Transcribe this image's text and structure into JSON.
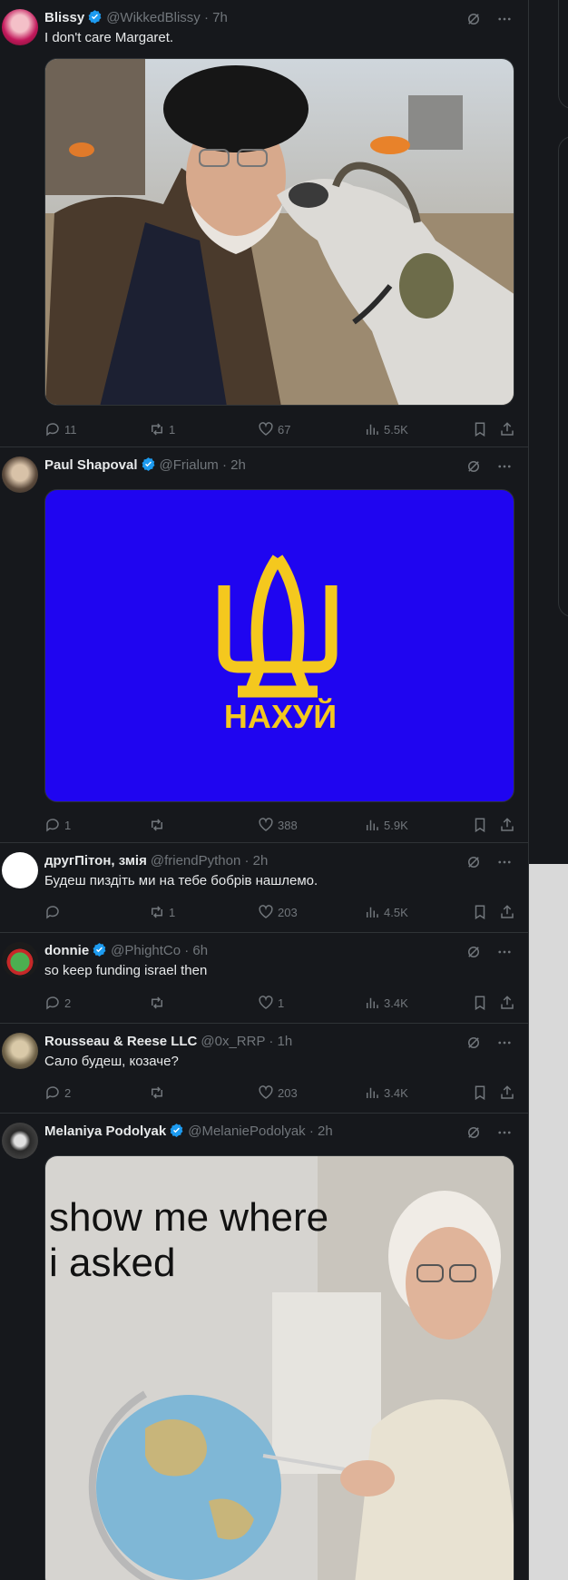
{
  "tweets": [
    {
      "name": "Blissy",
      "handle": "@WikkedBlissy · 7h",
      "text": "I don't care Margaret.",
      "verified": true,
      "replies": "11",
      "retweets": "1",
      "likes": "67",
      "views": "5.5K"
    },
    {
      "name": "Paul Shapoval",
      "handle": "@Frialum · 2h",
      "text": "",
      "verified": true,
      "media_caption": "НАХУЙ",
      "replies": "1",
      "retweets": "",
      "likes": "388",
      "views": "5.9K"
    },
    {
      "name": "другПітон, змія",
      "handle": "@friendPython · 2h",
      "text": "Будеш пиздіть ми на тебе бобрів нашлемо.",
      "verified": false,
      "replies": "",
      "retweets": "1",
      "likes": "203",
      "views": "4.5K"
    },
    {
      "name": "donnie",
      "handle": "@PhightCo · 6h",
      "text": "so keep funding israel then",
      "verified": true,
      "replies": "2",
      "retweets": "",
      "likes": "1",
      "views": "3.4K"
    },
    {
      "name": "Rousseau & Reese LLC",
      "handle": "@0x_RRP · 1h",
      "text": "Сало будеш, козаче?",
      "verified": false,
      "replies": "2",
      "retweets": "",
      "likes": "203",
      "views": "3.4K"
    },
    {
      "name": "Melaniya Podolyak",
      "handle": "@MelaniePodolyak · 2h",
      "text": "",
      "verified": true,
      "media_caption_1": "show me where",
      "media_caption_2": "i asked"
    }
  ],
  "colors": {
    "background": "#16181c",
    "text": "#e7e9ea",
    "muted": "#71767b",
    "verified": "#1d9bf0",
    "flag_blue": "#1f05f0",
    "flag_yellow": "#f4c81e"
  }
}
